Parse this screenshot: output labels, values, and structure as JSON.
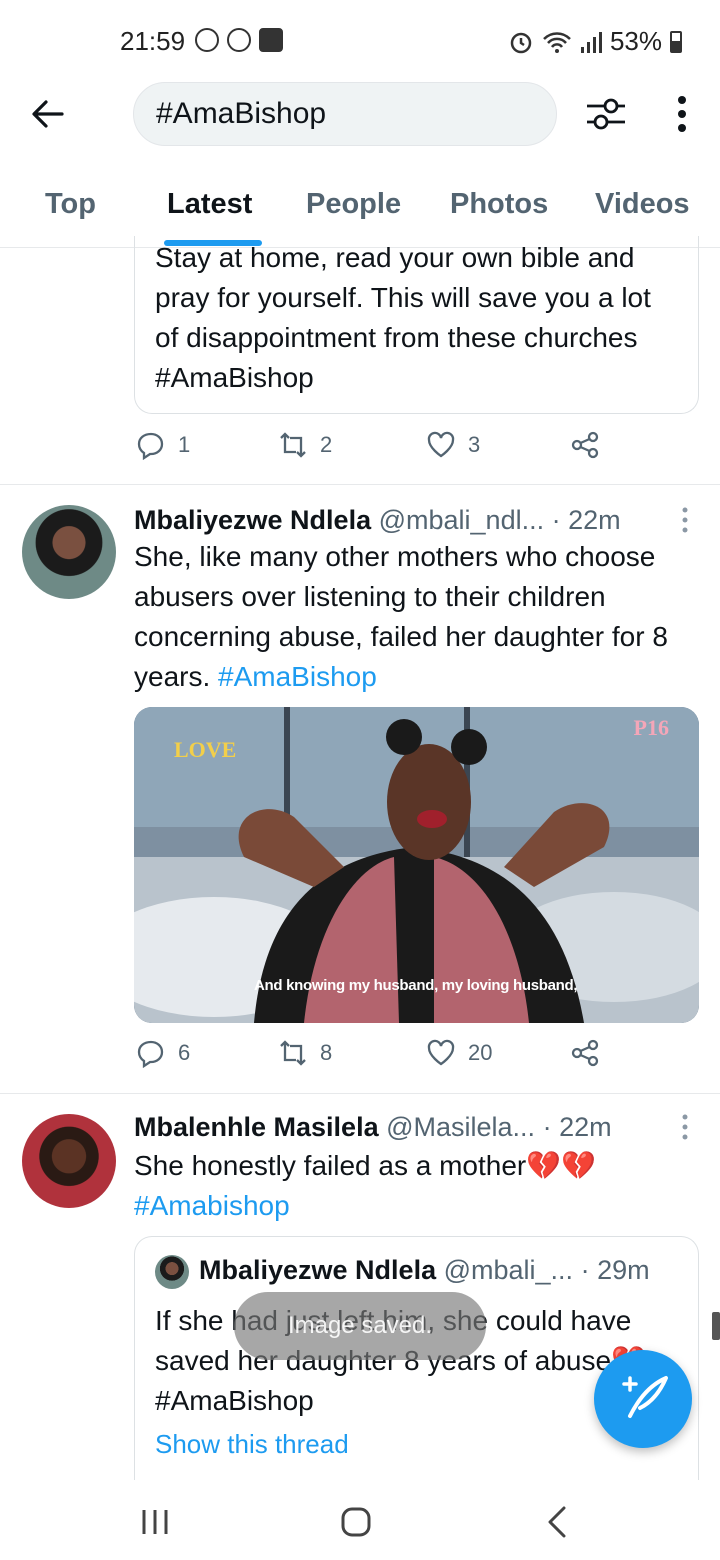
{
  "status_bar": {
    "time": "21:59",
    "battery": "53%"
  },
  "search": {
    "query": "#AmaBishop"
  },
  "tabs": [
    {
      "label": "Top"
    },
    {
      "label": "Latest"
    },
    {
      "label": "People"
    },
    {
      "label": "Photos"
    },
    {
      "label": "Videos"
    }
  ],
  "prev_tweet": {
    "quote_text": "Stay at home, read your own bible and pray for yourself. This will save you a lot of disappointment from these churches #AmaBishop",
    "replies": "1",
    "retweets": "2",
    "likes": "3"
  },
  "tweet1": {
    "name": "Mbaliyezwe Ndlela",
    "handle": "@mbali_ndl...",
    "time": "· 22m",
    "text": "She, like many other mothers who choose abusers over listening to their children concerning abuse, failed her daughter for 8 years.",
    "hashtag": "#AmaBishop",
    "media_caption": "And knowing my husband, my loving husband,",
    "media_logo": "LOVE",
    "media_channel": "P16",
    "replies": "6",
    "retweets": "8",
    "likes": "20"
  },
  "tweet2": {
    "name": "Mbalenhle Masilela",
    "handle": "@Masilela...",
    "time": "· 22m",
    "text": "She honestly failed as a mother💔💔",
    "hashtag": "#Amabishop",
    "quote": {
      "name": "Mbaliyezwe Ndlela",
      "handle": "@mbali_...",
      "time": "· 29m",
      "text": "If she had just left him, she could have saved her daughter 8 years of abuse💔 #AmaBishop",
      "link": "Show this thread"
    }
  },
  "toast": "Image saved.",
  "colors": {
    "accent": "#1d9bf0",
    "secondary_text": "#536471"
  }
}
